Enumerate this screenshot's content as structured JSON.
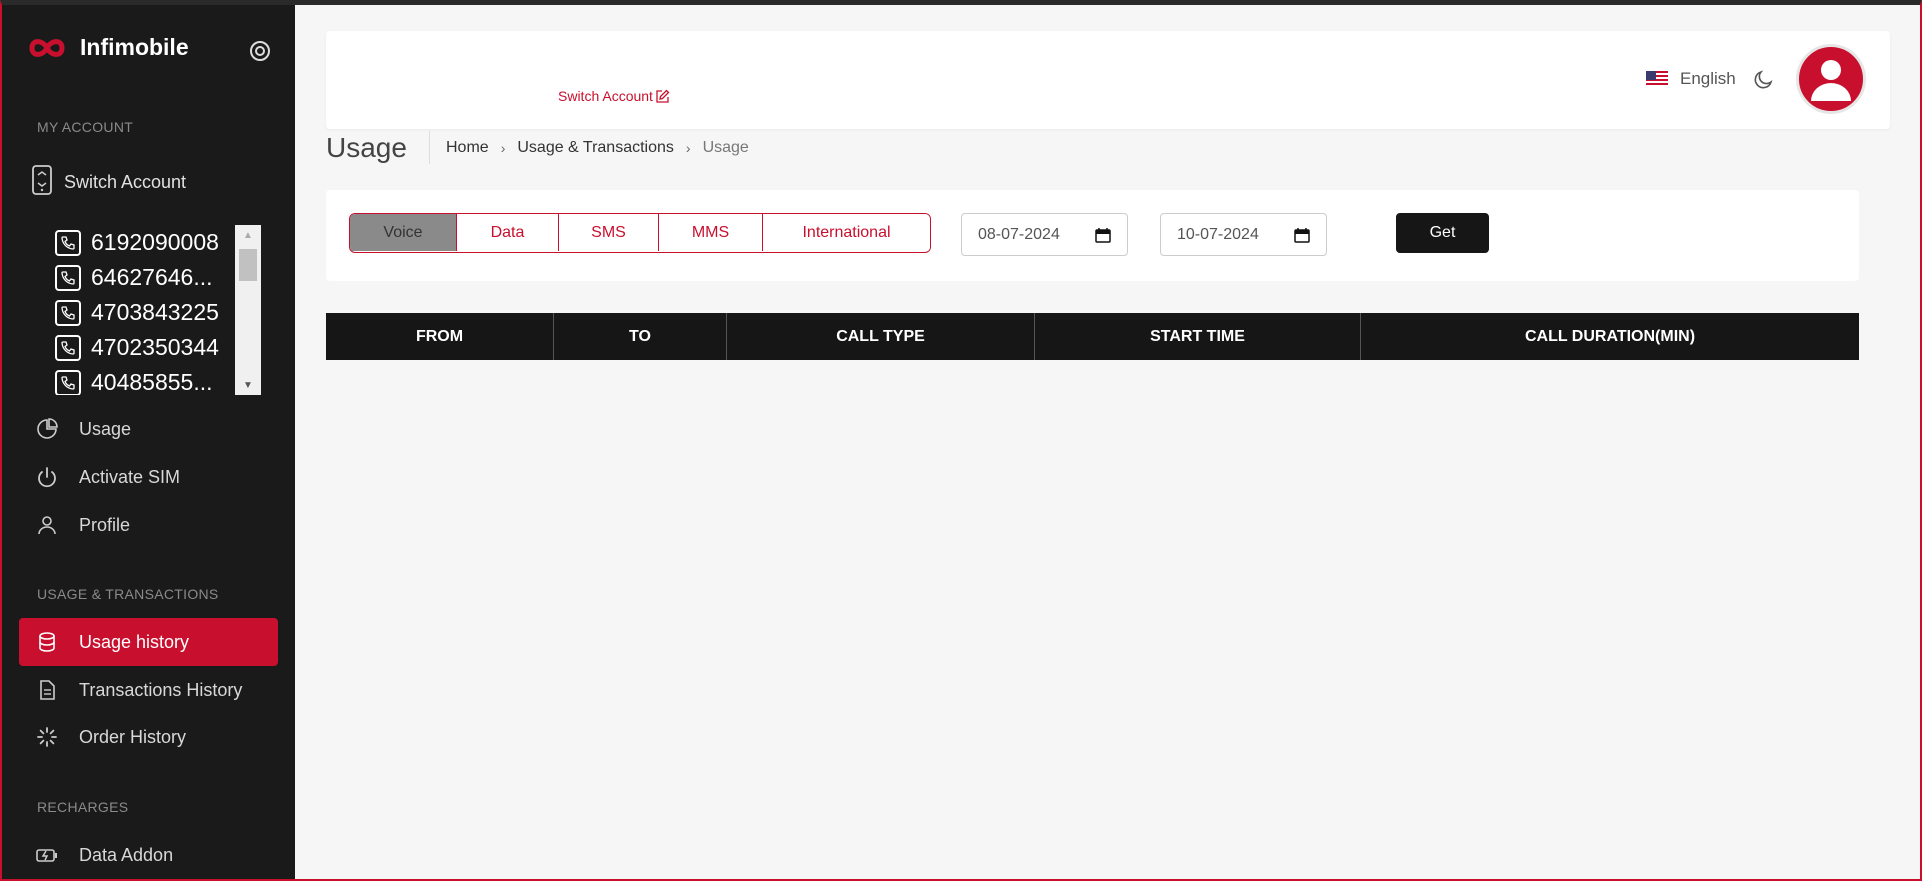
{
  "app": {
    "name": "Infimobile"
  },
  "sidebar": {
    "sections": {
      "my_account": "MY ACCOUNT",
      "usage_transactions": "USAGE & TRANSACTIONS",
      "recharges": "RECHARGES"
    },
    "switch_account": "Switch Account",
    "numbers": [
      "6192090008",
      "64627646...",
      "4703843225",
      "4702350344",
      "40485855..."
    ],
    "items": {
      "usage": "Usage",
      "activate_sim": "Activate SIM",
      "profile": "Profile",
      "usage_history": "Usage history",
      "transactions_history": "Transactions History",
      "order_history": "Order History",
      "data_addon": "Data Addon"
    }
  },
  "header": {
    "switch_account": "Switch Account",
    "language": "English"
  },
  "page": {
    "title": "Usage",
    "breadcrumb": [
      "Home",
      "Usage & Transactions",
      "Usage"
    ]
  },
  "filters": {
    "tabs": [
      "Voice",
      "Data",
      "SMS",
      "MMS",
      "International"
    ],
    "active_tab": "Voice",
    "from_date": "08-07-2024",
    "to_date": "10-07-2024",
    "get_label": "Get"
  },
  "table": {
    "columns": [
      "FROM",
      "TO",
      "CALL TYPE",
      "START TIME",
      "CALL DURATION(MIN)"
    ],
    "rows": []
  },
  "colors": {
    "accent": "#c8102e",
    "sidebar_bg": "#1a1a1a",
    "table_header_bg": "#161616"
  }
}
